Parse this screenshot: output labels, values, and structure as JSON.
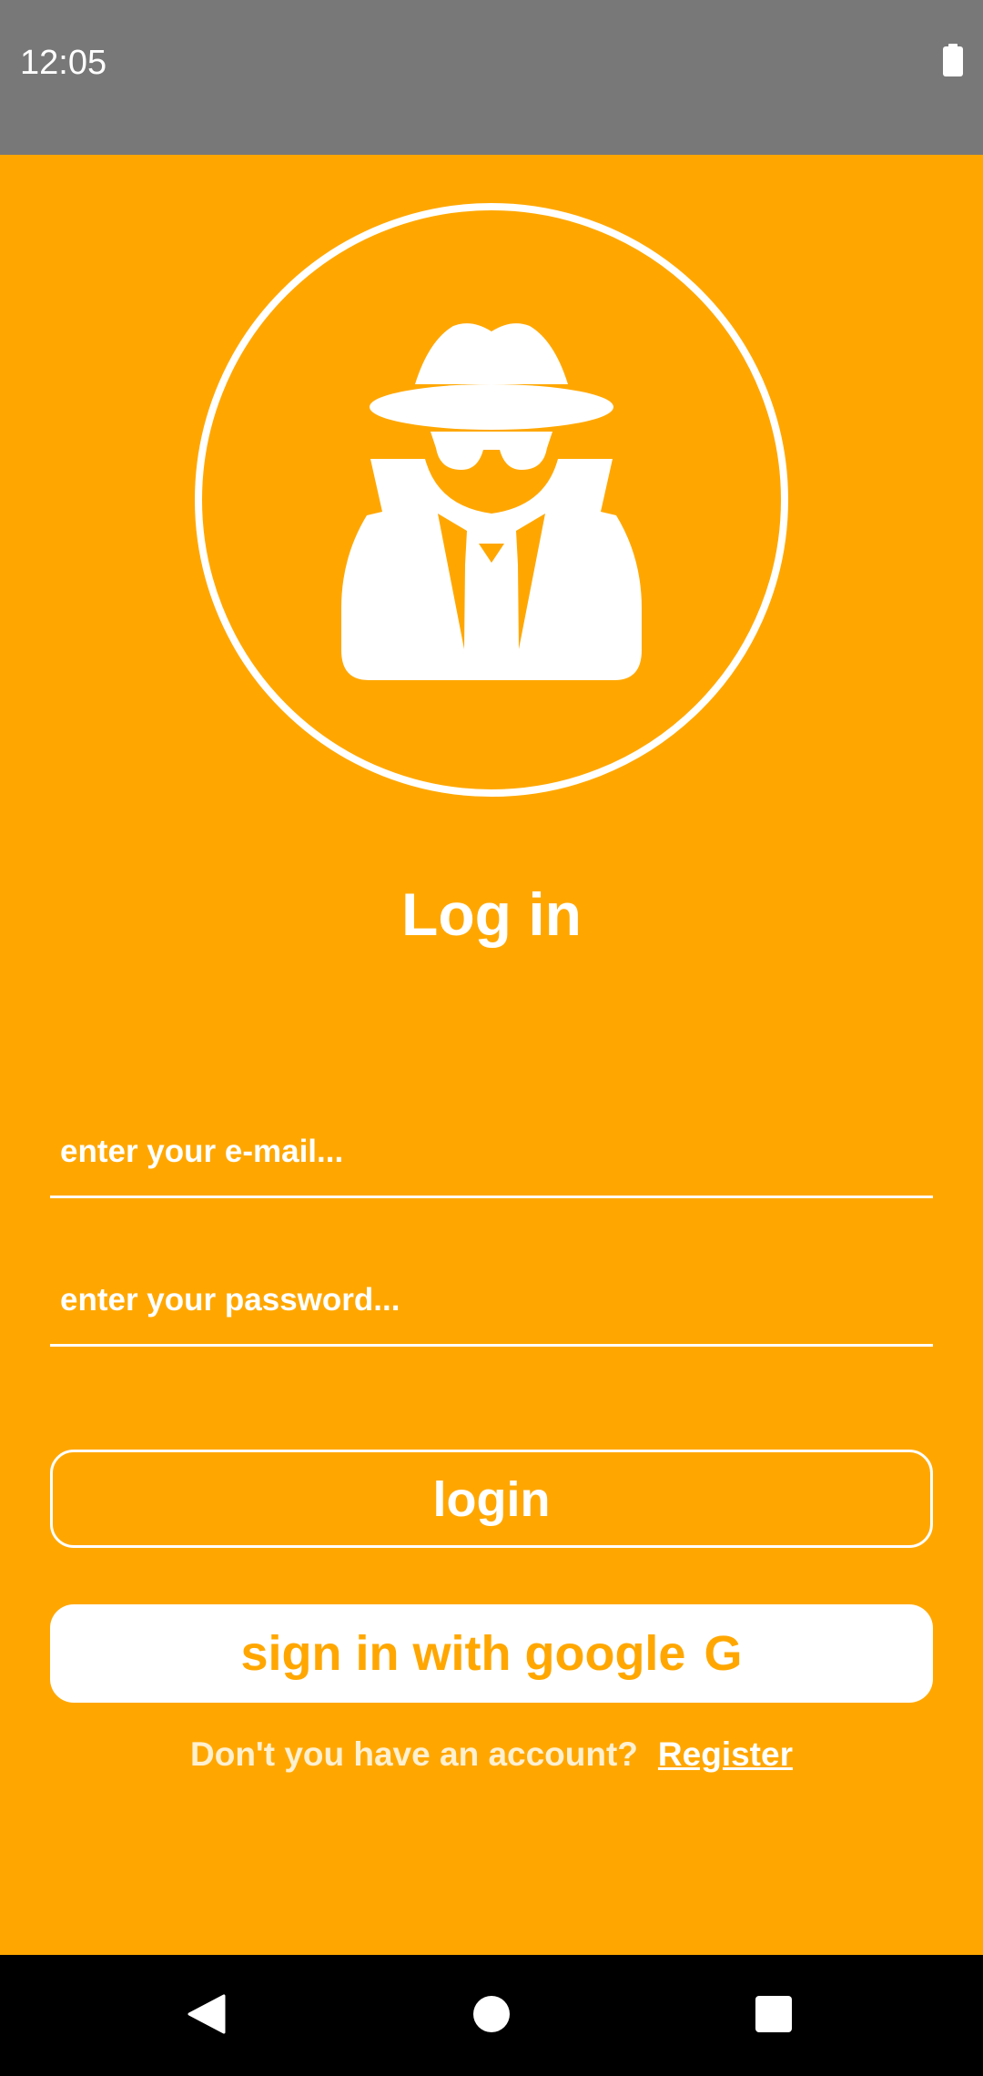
{
  "status_bar": {
    "time": "12:05",
    "battery_icon": "battery-full-icon"
  },
  "avatar": {
    "icon": "incognito-spy-icon"
  },
  "login_form": {
    "title": "Log in",
    "email_placeholder": "enter your e-mail...",
    "email_value": "",
    "password_placeholder": "enter your password...",
    "password_value": "",
    "login_label": "login",
    "google_label": "sign in with google",
    "google_icon_glyph": "G",
    "register_prompt": "Don't you have an account?",
    "register_link": "Register"
  },
  "nav_bar": {
    "back_icon": "back-triangle-icon",
    "home_icon": "home-circle-icon",
    "recents_icon": "recents-square-icon"
  },
  "colors": {
    "background": "#FFA700",
    "status_bar": "#787878",
    "nav_bar": "#000000",
    "text": "#FFFFFF",
    "google_button_text": "#FFA700"
  }
}
